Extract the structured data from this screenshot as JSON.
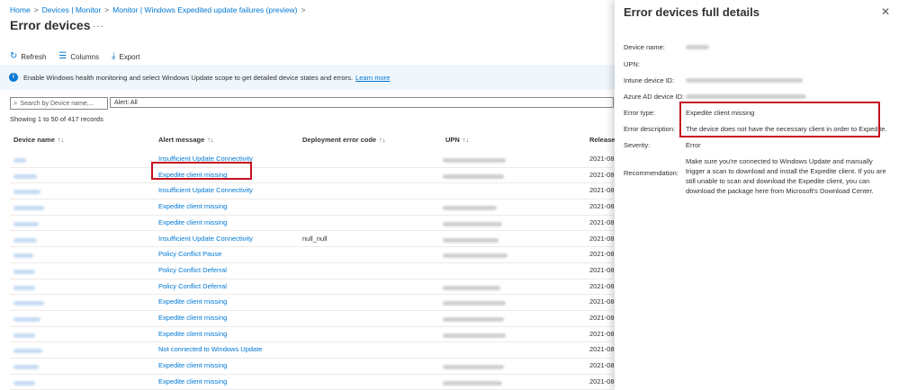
{
  "breadcrumb": {
    "items": [
      "Home",
      "Devices | Monitor",
      "Monitor | Windows Expedited update failures (preview)"
    ]
  },
  "page": {
    "title": "Error devices",
    "more": "···"
  },
  "toolbar": {
    "refresh_label": "Refresh",
    "columns_label": "Columns",
    "export_label": "Export"
  },
  "banner": {
    "text": "Enable Windows health monitoring and select Windows Update scope to get detailed device states and errors.",
    "link": "Learn more"
  },
  "search": {
    "placeholder": "Search by Device name,..."
  },
  "filter": {
    "label": "Alert: All"
  },
  "showing": "Showing 1 to 50 of 417 records",
  "table": {
    "headers": {
      "device_name": "Device name",
      "alert_message": "Alert message",
      "deployment_error_code": "Deployment error code",
      "upn": "UPN",
      "release": "Release"
    },
    "sort_icon": "↑↓",
    "rows": [
      {
        "alert": "Insufficient Update Connectivity",
        "code": "",
        "release": "2021-08"
      },
      {
        "alert": "Expedite client missing",
        "code": "",
        "release": "2021-08"
      },
      {
        "alert": "Insufficient Update Connectivity",
        "code": "",
        "release": "2021-08"
      },
      {
        "alert": "Expedite client missing",
        "code": "",
        "release": "2021-08"
      },
      {
        "alert": "Expedite client missing",
        "code": "",
        "release": "2021-08"
      },
      {
        "alert": "Insufficient Update Connectivity",
        "code": "null_null",
        "release": "2021-08"
      },
      {
        "alert": "Policy Conflict Pause",
        "code": "",
        "release": "2021-08"
      },
      {
        "alert": "Policy Conflict Deferral",
        "code": "",
        "release": "2021-08"
      },
      {
        "alert": "Policy Conflict Deferral",
        "code": "",
        "release": "2021-08"
      },
      {
        "alert": "Expedite client missing",
        "code": "",
        "release": "2021-08"
      },
      {
        "alert": "Expedite client missing",
        "code": "",
        "release": "2021-08"
      },
      {
        "alert": "Expedite client missing",
        "code": "",
        "release": "2021-08"
      },
      {
        "alert": "Not connected to Windows Update",
        "code": "",
        "release": "2021-08"
      },
      {
        "alert": "Expedite client missing",
        "code": "",
        "release": "2021-08"
      },
      {
        "alert": "Expedite client missing",
        "code": "",
        "release": "2021-08"
      }
    ]
  },
  "panel": {
    "title": "Error devices full details",
    "close": "✕",
    "labels": {
      "device_name": "Device name:",
      "upn": "UPN:",
      "intune_id": "Intune device ID:",
      "aad_id": "Azure AD device ID:",
      "error_type": "Error type:",
      "error_description": "Error description:",
      "severity": "Severity:",
      "recommendation": "Recommendation:"
    },
    "values": {
      "error_type": "Expedite client missing",
      "error_description": "The device does not have the necessary client in order to Expedite.",
      "severity": "Error",
      "recommendation": "Make sure you're connected to Windows Update and manually trigger a scan to download and install the Expedite client. If you are still unable to scan and download the Expedite client, you can download the package here from Microsoft's Download Center."
    }
  },
  "colors": {
    "accent": "#0078d4",
    "highlight_box": "#c50f1f",
    "banner_bg": "#eff6fc"
  }
}
